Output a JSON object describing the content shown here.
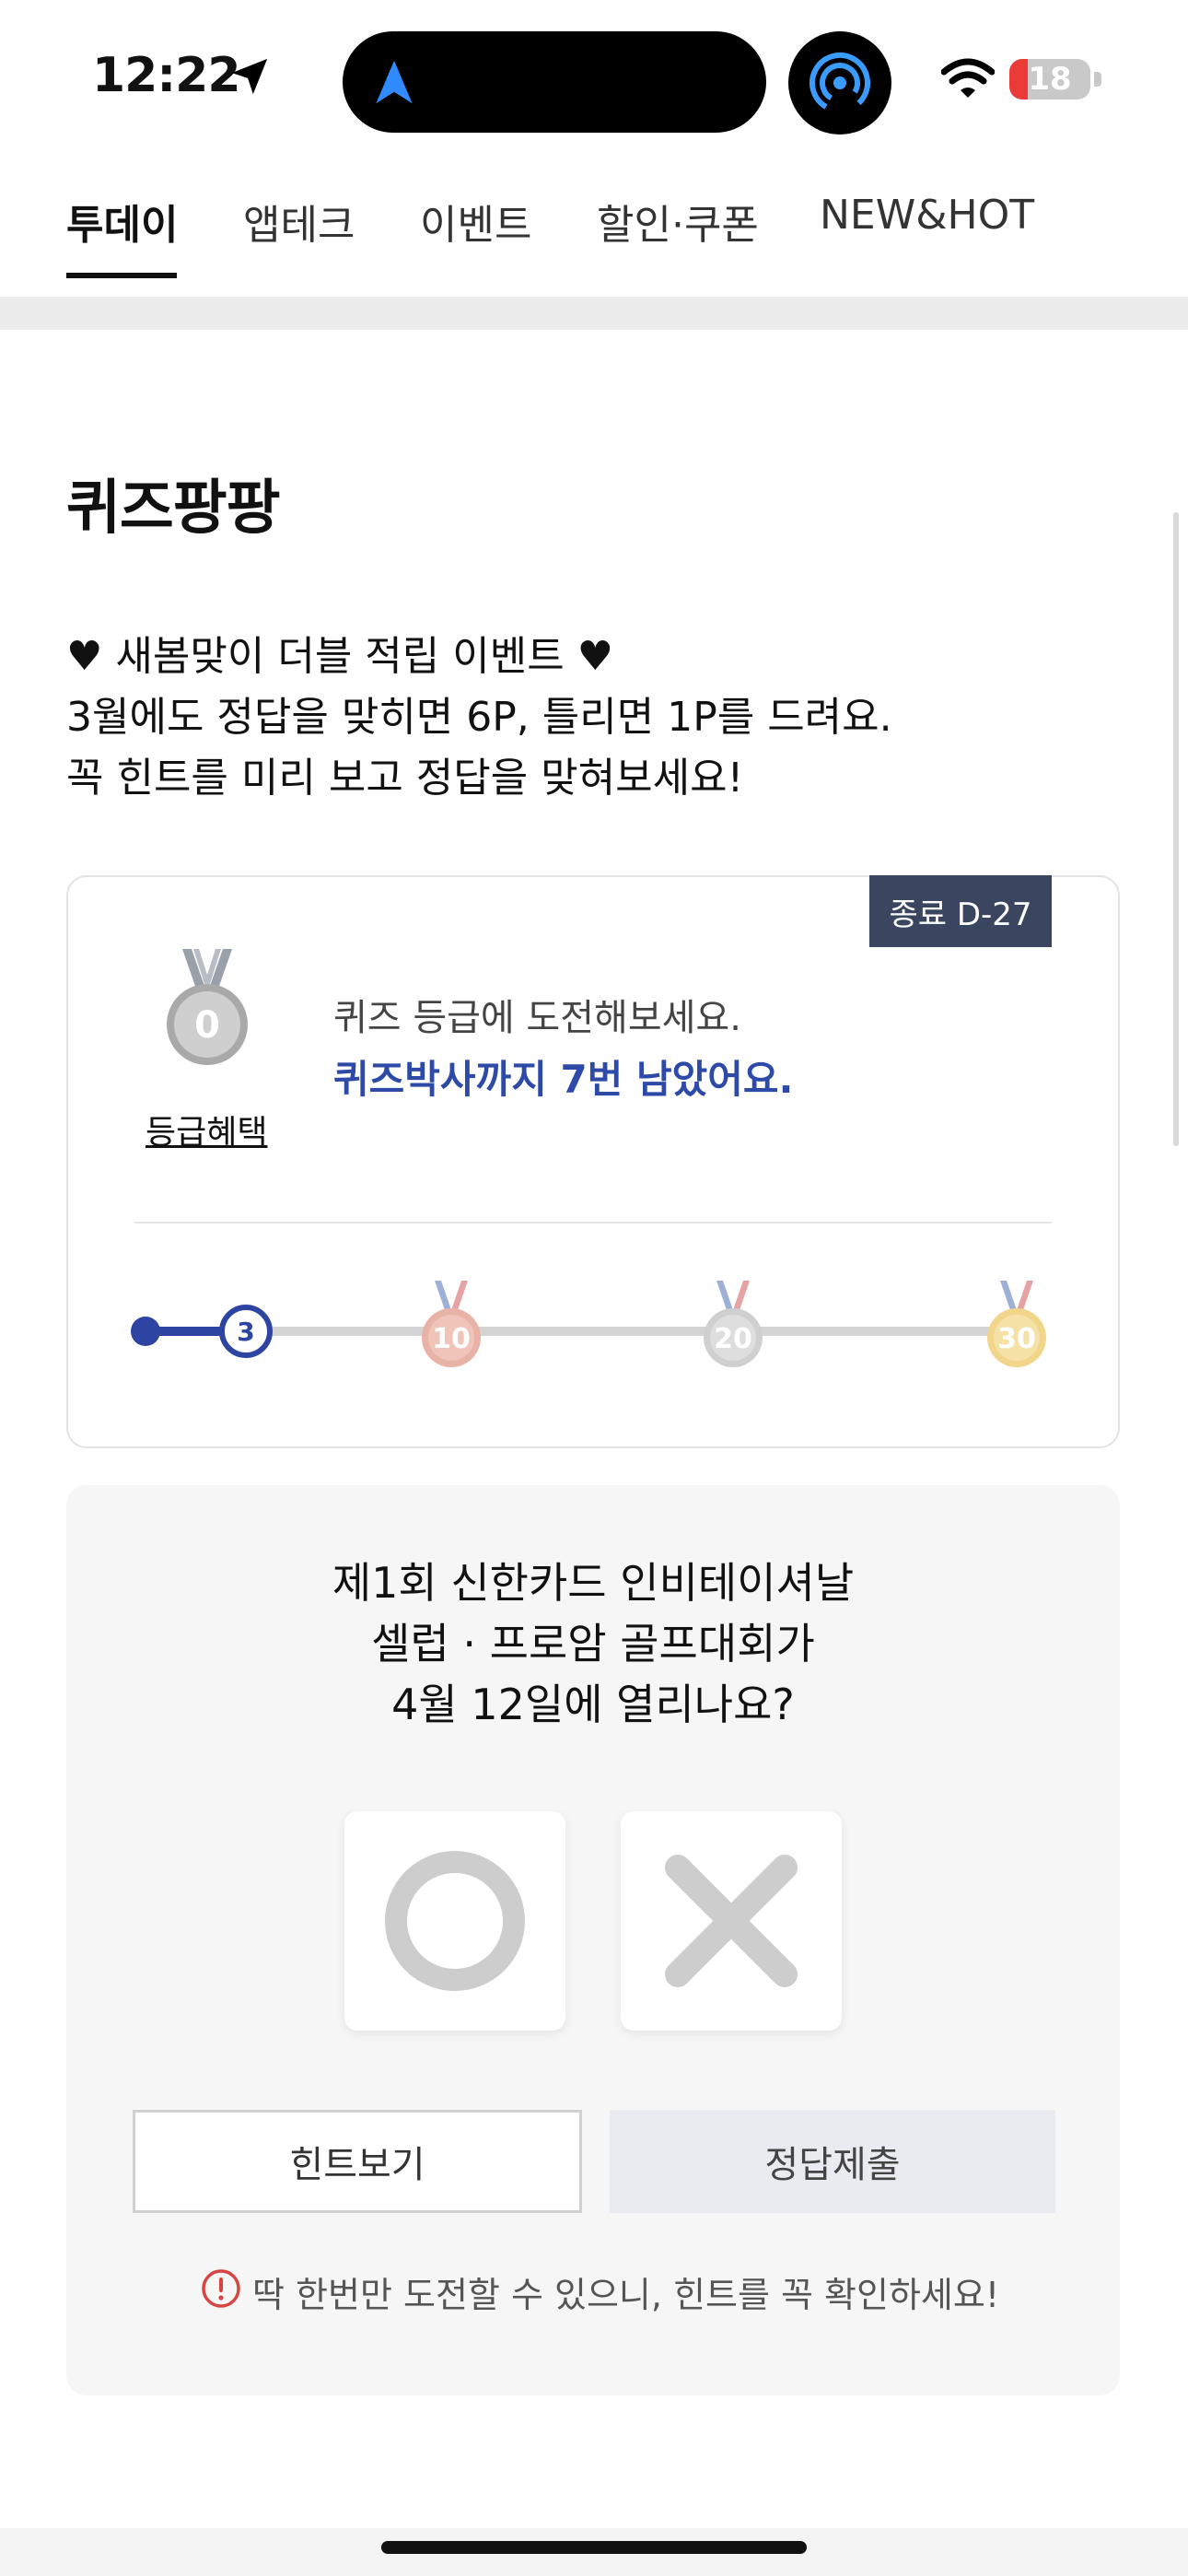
{
  "status_bar": {
    "time": "12:22",
    "battery_level": "18",
    "icons": [
      "location-arrow-icon",
      "navigation-icon",
      "airdrop-icon",
      "wifi-icon",
      "battery-icon"
    ]
  },
  "tabs": [
    {
      "label": "투데이",
      "active": true
    },
    {
      "label": "앱테크",
      "active": false
    },
    {
      "label": "이벤트",
      "active": false
    },
    {
      "label": "할인·쿠폰",
      "active": false
    },
    {
      "label": "NEW&HOT",
      "active": false
    }
  ],
  "section": {
    "title": "퀴즈팡팡",
    "description": [
      "♥ 새봄맞이 더블 적립 이벤트 ♥",
      "3월에도 정답을 맞히면 6P, 틀리면 1P를 드려요.",
      "꼭 힌트를 미리 보고 정답을 맞혀보세요!"
    ]
  },
  "grade_card": {
    "dday_label": "종료 D-27",
    "medal_value": "0",
    "benefit_link": "등급혜택",
    "message": "퀴즈 등급에 도전해보세요.",
    "highlight": "퀴즈박사까지 7번 남았어요.",
    "progress": {
      "current": "3",
      "current_value": 3,
      "milestones": [
        "10",
        "20",
        "30"
      ]
    }
  },
  "quiz": {
    "question_lines": [
      "제1회 신한카드 인비테이셔날",
      "셀럽 · 프로암 골프대회가",
      "4월 12일에 열리나요?"
    ],
    "hint_button": "힌트보기",
    "submit_button": "정답제출",
    "warning": "딱 한번만 도전할 수 있으니, 힌트를 꼭 확인하세요!"
  },
  "colors": {
    "accent_blue": "#2e44a3",
    "dday_bg": "#3a4560",
    "warning_red": "#d64541",
    "bronze": "#e4a99a",
    "silver": "#cfcfcf",
    "gold": "#f0d58a"
  }
}
